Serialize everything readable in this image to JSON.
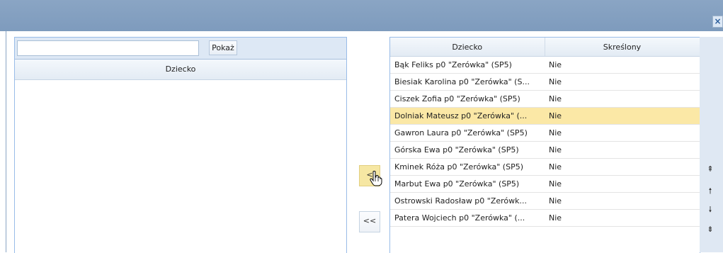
{
  "window": {
    "close_label": "×"
  },
  "left": {
    "search": {
      "value": "",
      "placeholder": ""
    },
    "show_label": "Pokaż",
    "column_header": "Dziecko"
  },
  "middle": {
    "move_one_label": "<",
    "move_all_label": "<<"
  },
  "right": {
    "headers": {
      "child": "Dziecko",
      "removed": "Skreślony"
    },
    "rows": [
      {
        "child": "Bąk Feliks p0 \"Zerówka\" (SP5)",
        "removed": "Nie"
      },
      {
        "child": "Biesiak Karolina p0 \"Zerówka\" (S...",
        "removed": "Nie"
      },
      {
        "child": "Ciszek Zofia p0 \"Zerówka\" (SP5)",
        "removed": "Nie"
      },
      {
        "child": "Dolniak Mateusz p0 \"Zerówka\" (...",
        "removed": "Nie"
      },
      {
        "child": "Gawron Laura p0 \"Zerówka\" (SP5)",
        "removed": "Nie"
      },
      {
        "child": "Górska Ewa p0 \"Zerówka\" (SP5)",
        "removed": "Nie"
      },
      {
        "child": "Kminek Róża p0 \"Zerówka\" (SP5)",
        "removed": "Nie"
      },
      {
        "child": "Marbut Ewa p0 \"Zerówka\" (SP5)",
        "removed": "Nie"
      },
      {
        "child": "Ostrowski Radosław p0 \"Zerówk...",
        "removed": "Nie"
      },
      {
        "child": "Patera Wojciech p0 \"Zerówka\" (...",
        "removed": "Nie"
      }
    ]
  },
  "order_controls": {
    "top_icon": "double-arrow-up-icon",
    "up_icon": "arrow-up-icon",
    "down_icon": "arrow-down-icon",
    "bottom_icon": "double-arrow-down-icon"
  },
  "colors": {
    "titlebar": "#8aa5c4",
    "selected_row": "#fbe8a6",
    "panel_border": "#99bce8"
  }
}
